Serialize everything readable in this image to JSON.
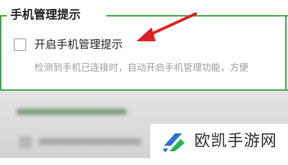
{
  "section": {
    "title": "手机管理提示",
    "checkbox_label": "开启手机管理提示",
    "description": "检测到手机已连接时，自动开启手机管理功能，方便"
  },
  "watermark": {
    "text": "欧凯手游网"
  },
  "colors": {
    "accent": "#3aa33e",
    "arrow": "#e02020",
    "logo_blue": "#2d6fd6",
    "logo_green": "#2cb35a"
  }
}
